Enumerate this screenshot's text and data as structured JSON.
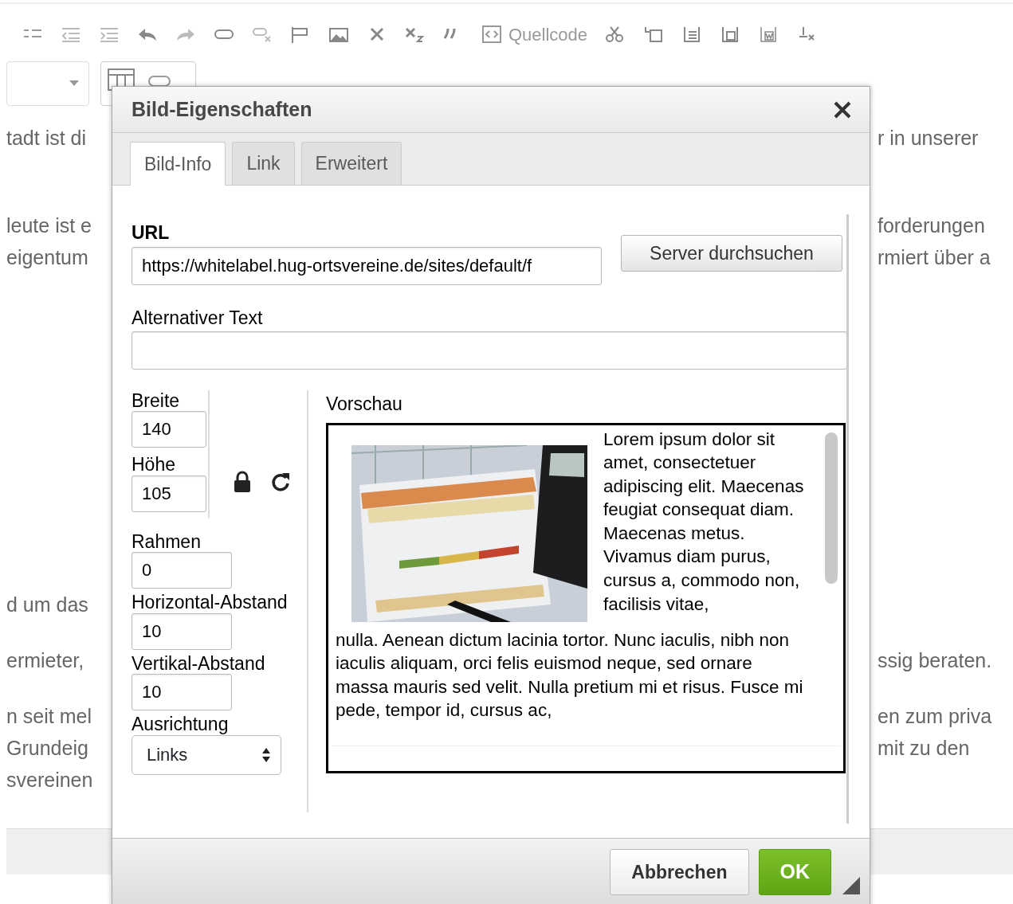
{
  "toolbar": {
    "source_label": "Quellcode"
  },
  "page_lines": [
    {
      "left": "tadt ist di",
      "right": "r in unserer"
    },
    {
      "left": "leute ist e",
      "right": "forderungen"
    },
    {
      "left": "eigentum",
      "right": "rmiert über a"
    },
    {
      "left": "d um das"
    },
    {
      "left": "ermieter,",
      "right": "ssig beraten."
    },
    {
      "left": "n seit mel",
      "right": "en zum priva"
    },
    {
      "left": "Grundeig",
      "right": "mit zu den"
    },
    {
      "left": "svereinen"
    }
  ],
  "dialog": {
    "title": "Bild-Eigenschaften",
    "tabs": [
      {
        "label": "Bild-Info",
        "selected": true
      },
      {
        "label": "Link",
        "selected": false
      },
      {
        "label": "Erweitert",
        "selected": false
      }
    ],
    "url": {
      "label": "URL",
      "value": "https://whitelabel.hug-ortsvereine.de/sites/default/f"
    },
    "browse_button": "Server durchsuchen",
    "alt_text": {
      "label": "Alternativer Text"
    },
    "width": {
      "label": "Breite",
      "value": "140"
    },
    "height": {
      "label": "Höhe",
      "value": "105"
    },
    "border": {
      "label": "Rahmen",
      "value": "0"
    },
    "hspace": {
      "label": "Horizontal-Abstand",
      "value": "10"
    },
    "vspace": {
      "label": "Vertikal-Abstand",
      "value": "10"
    },
    "alignment": {
      "label": "Ausrichtung",
      "value": "Links"
    },
    "preview": {
      "label": "Vorschau",
      "text_beside_image": "Lorem ipsum dolor sit amet, consectetuer adipiscing elit. Maecenas feugiat consequat diam. Maecenas metus. Vivamus diam purus, cursus a, commodo non, facilisis vitae,",
      "text_below_image": "nulla. Aenean dictum lacinia tortor. Nunc iaculis, nibh non iaculis aliquam, orci felis euismod neque, sed ornare massa mauris sed velit. Nulla pretium mi et risus. Fusce mi pede, tempor id, cursus ac,"
    },
    "buttons": [
      {
        "label": "Abbrechen",
        "kind": "cancel"
      },
      {
        "label": "OK",
        "kind": "ok"
      }
    ]
  }
}
